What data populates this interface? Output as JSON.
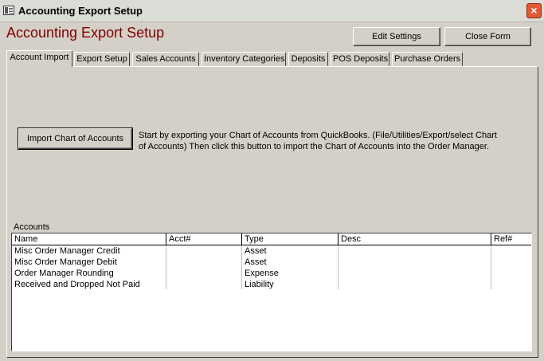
{
  "window": {
    "title": "Accounting Export Setup",
    "close_glyph": "×"
  },
  "form": {
    "title": "Accounting Export Setup"
  },
  "buttons": {
    "edit_settings": "Edit Settings",
    "close_form": "Close Form",
    "import_chart": "Import Chart of Accounts"
  },
  "tabs": [
    "Account Import",
    "Export Setup",
    "Sales Accounts",
    "Inventory Categories",
    "Deposits",
    "POS Deposits",
    "Purchase Orders"
  ],
  "instructions": "Start by exporting your Chart of Accounts from QuickBooks. (File/Utilities/Export/select Chart of Accounts) Then click this button to import the Chart of Accounts into the Order Manager.",
  "accounts": {
    "label": "Accounts",
    "columns": [
      "Name",
      "Acct#",
      "Type",
      "Desc",
      "Ref#"
    ],
    "rows": [
      [
        "Misc Order Manager Credit",
        "",
        "Asset",
        "",
        ""
      ],
      [
        "Misc Order Manager Debit",
        "",
        "Asset",
        "",
        ""
      ],
      [
        "Order Manager Rounding",
        "",
        "Expense",
        "",
        ""
      ],
      [
        "Received and Dropped Not Paid",
        "",
        "Liability",
        "",
        ""
      ]
    ]
  },
  "colors": {
    "title_red": "#800000",
    "face": "#d4d0c8",
    "close_button": "#e05a35"
  }
}
